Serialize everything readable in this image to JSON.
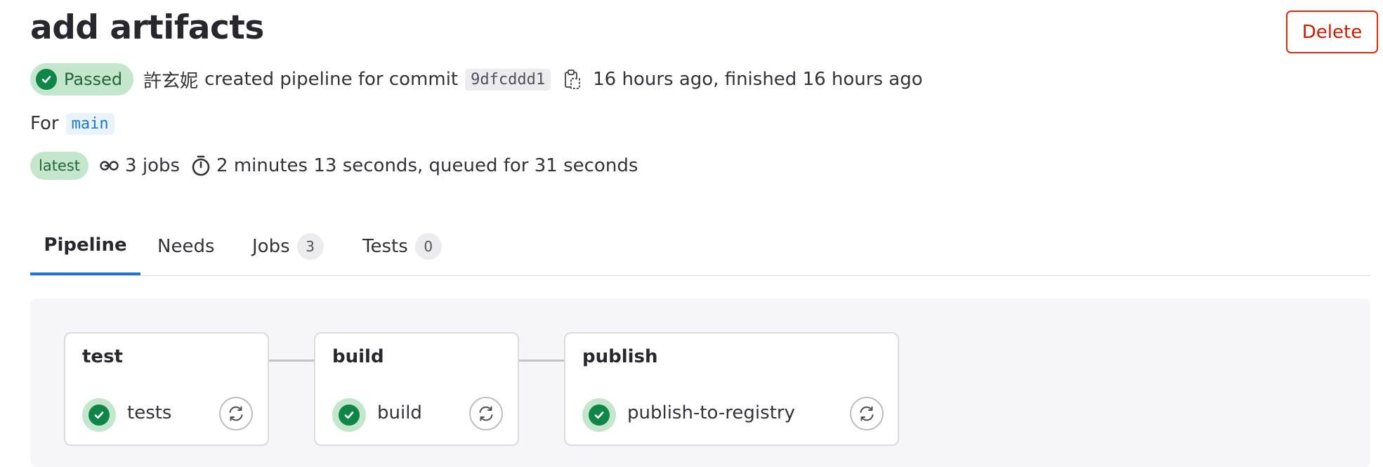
{
  "header": {
    "title": "add artifacts",
    "delete_label": "Delete"
  },
  "meta": {
    "status": "Passed",
    "author": "許玄妮",
    "created_text": "created pipeline for commit",
    "commit_sha": "9dfcddd1",
    "timing": "16 hours ago, finished 16 hours ago",
    "for_label": "For",
    "branch": "main",
    "latest_badge": "latest",
    "jobs_text": "3 jobs",
    "duration": "2 minutes 13 seconds, queued for 31 seconds"
  },
  "tabs": [
    {
      "label": "Pipeline",
      "active": true
    },
    {
      "label": "Needs"
    },
    {
      "label": "Jobs",
      "count": "3"
    },
    {
      "label": "Tests",
      "count": "0"
    }
  ],
  "stages": [
    {
      "name": "test",
      "job": "tests",
      "status": "success"
    },
    {
      "name": "build",
      "job": "build",
      "status": "success"
    },
    {
      "name": "publish",
      "job": "publish-to-registry",
      "status": "success"
    }
  ],
  "colors": {
    "success": "#108548",
    "success_bg": "#c3e6cd",
    "danger": "#dd2b0e",
    "active_tab": "#1f75cb"
  },
  "icons": {
    "status": "check-circle-icon",
    "copy": "clipboard-icon",
    "jobs": "pipeline-icon",
    "timer": "timer-icon",
    "retry": "retry-icon"
  }
}
